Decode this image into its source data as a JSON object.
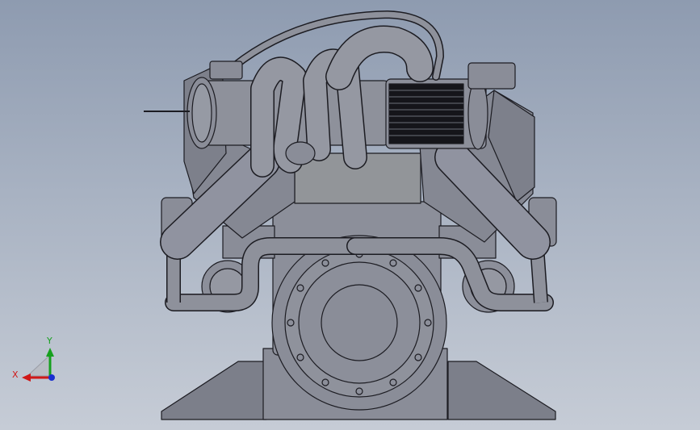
{
  "viewport": {
    "background_top": "#8e9bb0",
    "background_bottom": "#c6ccd6",
    "model_fill": "#8c8f9a",
    "model_shade": "#767984",
    "model_light": "#a3a6b0",
    "edge_color": "#1c1c22"
  },
  "triad": {
    "y_label": "Y",
    "x_label": "X",
    "y_color": "#16a01e",
    "x_color": "#d01818",
    "z_color": "#1a2fd0"
  }
}
